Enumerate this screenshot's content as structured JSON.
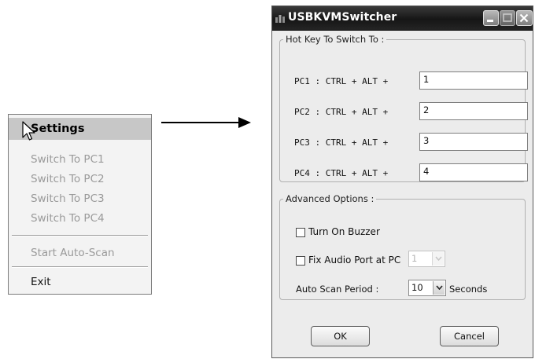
{
  "context_menu": {
    "header": "Settings",
    "items": [
      "Switch To PC1",
      "Switch To PC2",
      "Switch To PC3",
      "Switch To PC4"
    ],
    "auto_scan": "Start Auto-Scan",
    "exit": "Exit"
  },
  "window": {
    "title": "USBKVMSwitcher",
    "hotkey_group": {
      "legend": "Hot Key To Switch To :",
      "rows": [
        {
          "label": "PC1 : CTRL + ALT +",
          "value": "1"
        },
        {
          "label": "PC2 : CTRL + ALT +",
          "value": "2"
        },
        {
          "label": "PC3 : CTRL + ALT +",
          "value": "3"
        },
        {
          "label": "PC4 : CTRL + ALT +",
          "value": "4"
        }
      ]
    },
    "advanced_group": {
      "legend": "Advanced Options :",
      "buzzer_label": "Turn On Buzzer",
      "buzzer_checked": false,
      "audio_label": "Fix Audio Port at PC",
      "audio_checked": false,
      "audio_pc_value": "1",
      "scan_label": "Auto Scan Period :",
      "scan_value": "10",
      "scan_unit": "Seconds"
    },
    "ok_label": "OK",
    "cancel_label": "Cancel"
  }
}
